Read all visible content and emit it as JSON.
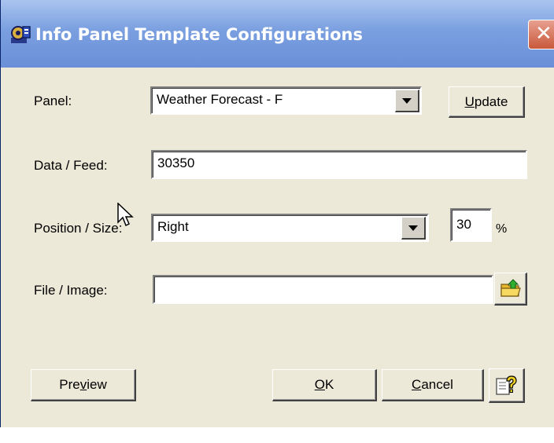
{
  "window": {
    "title": "Info Panel Template Configurations",
    "close_glyph": "✕",
    "title_icon": "gear-config-icon"
  },
  "form": {
    "panel": {
      "label": "Panel:",
      "value": "Weather Forecast - F"
    },
    "update_button": {
      "pre": "",
      "accel": "U",
      "post": "pdate"
    },
    "data_feed": {
      "label": "Data / Feed:",
      "value": "30350"
    },
    "position_size": {
      "label": "Position / Size:",
      "value": "Right",
      "size_value": "30",
      "size_unit": "%"
    },
    "file_image": {
      "label": "File / Image:",
      "value": "",
      "browse_icon": "folder-up-icon"
    }
  },
  "footer": {
    "preview_button": {
      "pre": "Pre",
      "accel": "v",
      "post": "iew"
    },
    "ok_button": {
      "pre": "",
      "accel": "O",
      "post": "K"
    },
    "cancel_button": {
      "pre": "",
      "accel": "C",
      "post": "ancel"
    },
    "help_icon": "help-question-icon"
  },
  "colors": {
    "titlebar": "#7a9fe0",
    "face": "#ece9d8",
    "close": "#c8583a"
  }
}
